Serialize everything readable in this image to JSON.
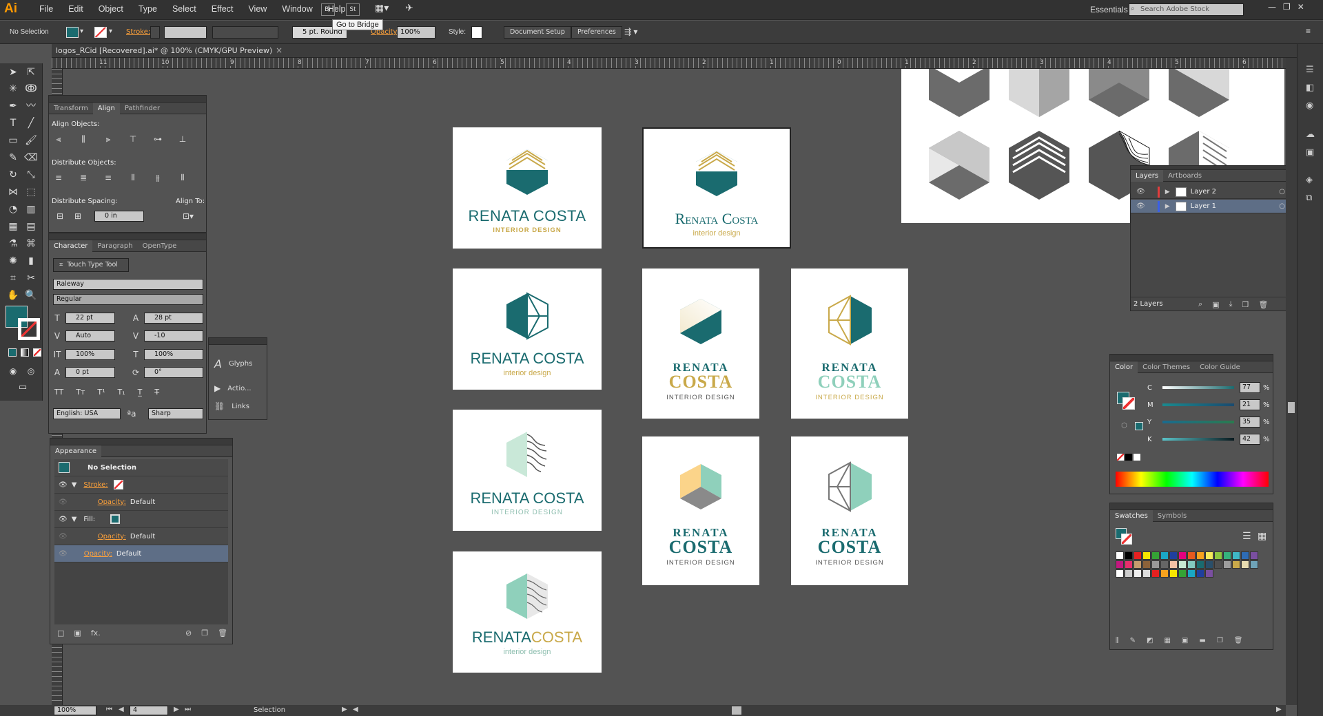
{
  "app": {
    "logo": "Ai"
  },
  "menu": [
    "File",
    "Edit",
    "Object",
    "Type",
    "Select",
    "Effect",
    "View",
    "Window",
    "Help"
  ],
  "menubar_buttons": {
    "bridge": "Br",
    "stock": "St"
  },
  "tooltip": "Go to Bridge",
  "workspace": "Essentials",
  "search_stock_placeholder": "Search Adobe Stock",
  "control": {
    "selection": "No Selection",
    "stroke_label": "Stroke:",
    "brush": "5 pt. Round",
    "opacity_label": "Opacity:",
    "opacity_value": "100%",
    "style_label": "Style:",
    "doc_setup": "Document Setup",
    "preferences": "Preferences"
  },
  "document_tab": "logos_RCid [Recovered].ai* @ 100% (CMYK/GPU Preview)",
  "ruler_ticks": [
    "11",
    "10",
    "9",
    "8",
    "7",
    "6",
    "5",
    "4",
    "3",
    "2",
    "1",
    "0",
    "1",
    "2",
    "3",
    "4",
    "5",
    "6"
  ],
  "align_panel": {
    "tabs": [
      "Transform",
      "Align",
      "Pathfinder"
    ],
    "align_objects": "Align Objects:",
    "distribute_objects": "Distribute Objects:",
    "distribute_spacing": "Distribute Spacing:",
    "align_to": "Align To:",
    "spacing_value": "0 in"
  },
  "character_panel": {
    "tabs": [
      "Character",
      "Paragraph",
      "OpenType"
    ],
    "touch_type": "Touch Type Tool",
    "font": "Raleway",
    "style": "Regular",
    "size": "22 pt",
    "leading": "28 pt",
    "kerning": "Auto",
    "tracking": "-10",
    "vscale": "100%",
    "hscale": "100%",
    "baseline": "0 pt",
    "rotation": "0°",
    "language": "English: USA",
    "antialias": "Sharp"
  },
  "mini_panel": [
    "Glyphs",
    "Actio...",
    "Links"
  ],
  "appearance_panel": {
    "title": "Appearance",
    "selection": "No Selection",
    "stroke": "Stroke:",
    "opacity": "Opacity:",
    "default": "Default",
    "fill": "Fill:"
  },
  "layers_panel": {
    "tabs": [
      "Layers",
      "Artboards"
    ],
    "layers": [
      {
        "name": "Layer 2",
        "color": "#e23c3c"
      },
      {
        "name": "Layer 1",
        "color": "#3a5fe8"
      }
    ],
    "count": "2 Layers"
  },
  "color_panel": {
    "tabs": [
      "Color",
      "Color Themes",
      "Color Guide"
    ],
    "channels": [
      {
        "label": "C",
        "value": "77",
        "unit": "%"
      },
      {
        "label": "M",
        "value": "21",
        "unit": "%"
      },
      {
        "label": "Y",
        "value": "35",
        "unit": "%"
      },
      {
        "label": "K",
        "value": "42",
        "unit": "%"
      }
    ]
  },
  "swatches_panel": {
    "tabs": [
      "Swatches",
      "Symbols"
    ],
    "colors": [
      "#ffffff",
      "#000000",
      "#e62020",
      "#f7e600",
      "#35a335",
      "#1aa7c4",
      "#1f3f9e",
      "#e4007f",
      "#e65a1e",
      "#f7a21e",
      "#f5ea5a",
      "#8ec63f",
      "#34b37d",
      "#3fb7c5",
      "#2e6cb5",
      "#7a4fa0",
      "#c2187f",
      "#e72f6d",
      "#c69c6d",
      "#8c6239",
      "#999999",
      "#666666",
      "#f4c0a4",
      "#c7e8d3",
      "#83c9c0",
      "#1a6b6f",
      "#2a4f6a",
      "#4f4f4f",
      "#9e9e9e",
      "#c9a94a",
      "#e8dcb0",
      "#6fa3b8",
      "#ffffff",
      "#cccccc",
      "#eeeeee",
      "#dddddd",
      "#e62020",
      "#f7a21e",
      "#f7e600",
      "#35a335",
      "#1aa7c4",
      "#1f3f9e",
      "#7a4fa0"
    ]
  },
  "brand": {
    "name1": "RENATA COSTA",
    "name_sc": "Renata Costa",
    "first": "RENATA",
    "last": "COSTA",
    "sub_upper": "INTERIOR DESIGN",
    "sub_lower": "interior design"
  },
  "status": {
    "zoom": "100%",
    "artboard": "4",
    "tool": "Selection"
  },
  "colors": {
    "teal": "#1a6b6f",
    "gold": "#c9a94a",
    "mint": "#8fd0bb",
    "grey": "#6b6b6b"
  }
}
